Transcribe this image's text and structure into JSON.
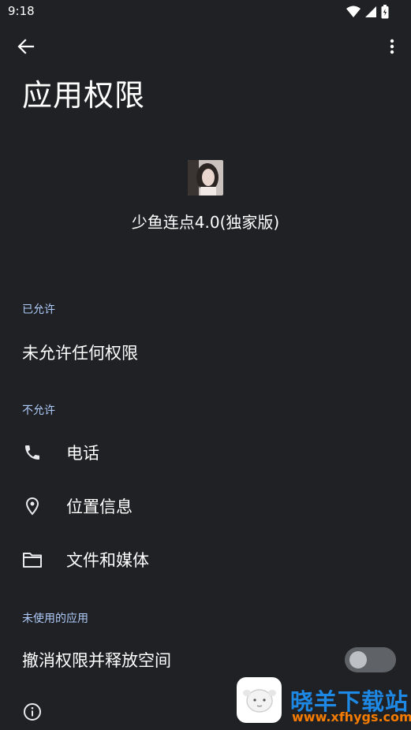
{
  "status_bar": {
    "time": "9:18"
  },
  "toolbar": {
    "back_icon": "arrow-back-icon",
    "more_icon": "more-vert-icon"
  },
  "page": {
    "title": "应用权限"
  },
  "app": {
    "name": "少鱼连点4.0(独家版)"
  },
  "allowed": {
    "header": "已允许",
    "empty_text": "未允许任何权限"
  },
  "denied": {
    "header": "不允许",
    "items": [
      {
        "label": "电话",
        "icon": "phone-icon"
      },
      {
        "label": "位置信息",
        "icon": "location-pin-icon"
      },
      {
        "label": "文件和媒体",
        "icon": "folder-icon"
      }
    ]
  },
  "unused_apps": {
    "header": "未使用的应用",
    "toggle_label": "撤消权限并释放空间",
    "toggle_on": false
  },
  "footer": {
    "icon": "info-icon"
  },
  "watermark": {
    "title": "晓羊下载站",
    "url": "www.xfhygs.com"
  },
  "colors": {
    "background": "#202124",
    "section_header": "#aecbfa",
    "text": "#ffffff"
  }
}
